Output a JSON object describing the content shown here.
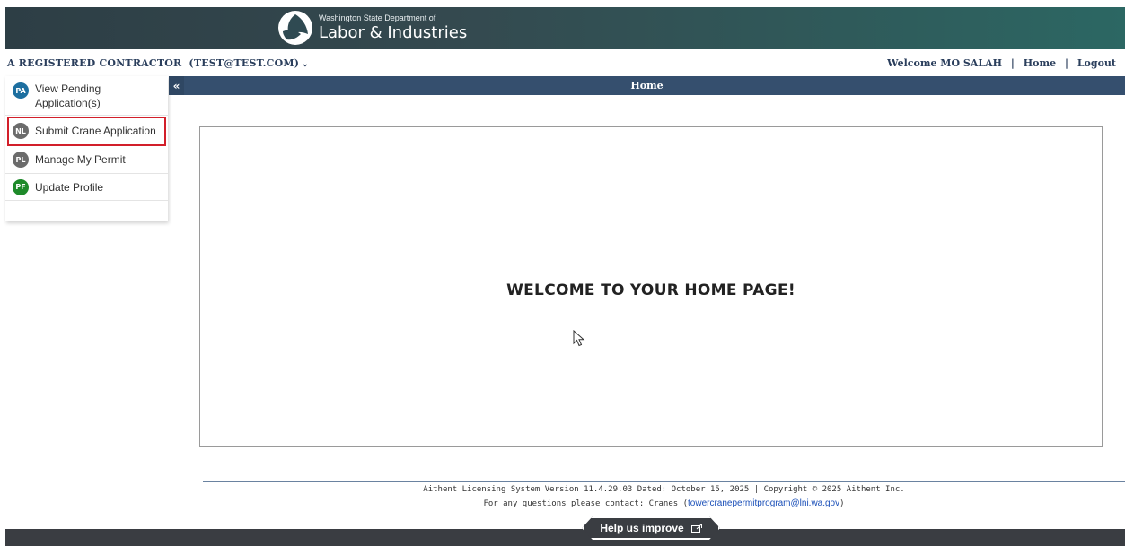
{
  "header": {
    "logo_small": "Washington State Department of",
    "logo_big": "Labor & Industries",
    "logo_icon": "lni-logo-icon"
  },
  "account": {
    "name": "A REGISTERED CONTRACTOR  (TEST@TEST.COM)",
    "chevron": "⌄",
    "welcome": "Welcome MO SALAH",
    "home_link": "Home",
    "logout_link": "Logout",
    "separator": "|"
  },
  "titlebar": {
    "collapse": "«",
    "title": "Home"
  },
  "sidebar": {
    "items": [
      {
        "badge": "PA",
        "label": "View Pending Application(s)",
        "color": "#1d6fa0"
      },
      {
        "badge": "NL",
        "label": "Submit Crane Application",
        "color": "#6b6b6b"
      },
      {
        "badge": "PL",
        "label": "Manage My Permit",
        "color": "#6b6b6b"
      },
      {
        "badge": "PF",
        "label": "Update Profile",
        "color": "#1e8a2a"
      }
    ],
    "highlight_color": "#d21f2a"
  },
  "main": {
    "welcome": "WELCOME TO YOUR HOME PAGE!"
  },
  "footer": {
    "version_line": "Aithent Licensing System Version 11.4.29.03 Dated: October 15, 2025 | Copyright © 2025 Aithent Inc.",
    "contact_prefix": "For any questions please contact: Cranes (",
    "contact_email": "towercranepermitprogram@lni.wa.gov",
    "contact_suffix": ")",
    "help_label": "Help us improve",
    "help_icon": "external-link-icon"
  },
  "colors": {
    "title_bar": "#354f6e",
    "account_text": "#2a3e5c",
    "bottom_bar": "#3a3d42"
  }
}
